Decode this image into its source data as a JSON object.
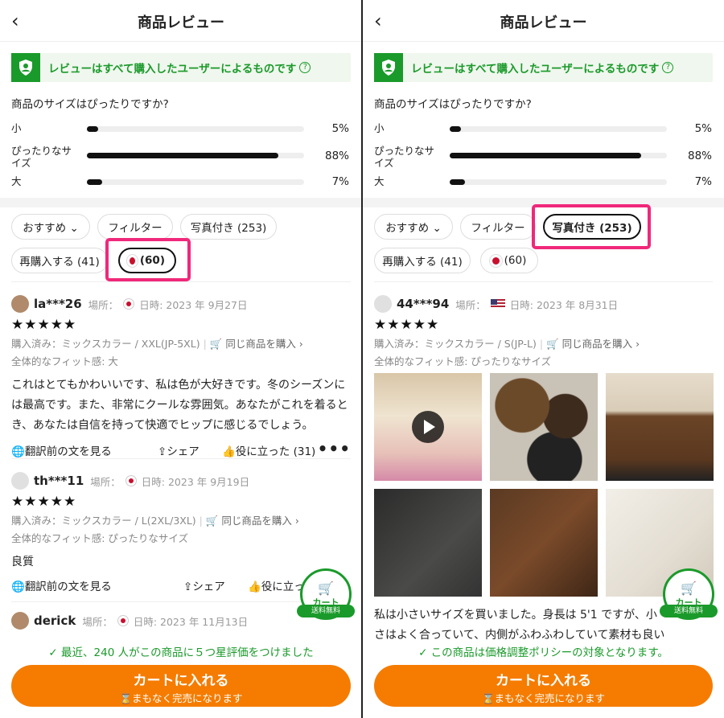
{
  "left": {
    "header": {
      "title": "商品レビュー",
      "back_icon": "‹"
    },
    "banner": {
      "text": "レビューはすべて購入したユーザーによるものです",
      "help_icon": "?"
    },
    "fit": {
      "question": "商品のサイズはぴったりですか?",
      "rows": [
        {
          "label": "小",
          "pct": "5%",
          "value": 0.05
        },
        {
          "label": "ぴったりなサイズ",
          "pct": "88%",
          "value": 0.88
        },
        {
          "label": "大",
          "pct": "7%",
          "value": 0.07
        }
      ]
    },
    "chips": {
      "sort": "おすすめ ⌄",
      "filter": "フィルター",
      "photos": "写真付き (253)",
      "repurchase": "再購入する (41)",
      "country": "(60)"
    },
    "reviews": [
      {
        "user": "la***26",
        "location_label": "場所：",
        "date": "日時: 2023 年 9月27日",
        "stars": "★★★★★",
        "purchased": "購入済み：ミックスカラー / XXL(JP-5XL)",
        "same_item": "同じ商品を購入 ›",
        "fit": "全体的なフィット感: 大",
        "text": "これはとてもかわいいです、私は色が大好きです。冬のシーズンには最高です。また、非常にクールな雰囲気。あなたがこれを着るとき、あなたは自信を持って快適でヒップに感じるでしょう。",
        "translate": "翻訳前の文を見る",
        "share": "シェア",
        "useful": "役に立った (31)"
      },
      {
        "user": "th***11",
        "location_label": "場所：",
        "date": "日時: 2023 年 9月19日",
        "stars": "★★★★★",
        "purchased": "購入済み：ミックスカラー / L(2XL/3XL)",
        "same_item": "同じ商品を購入 ›",
        "fit": "全体的なフィット感: ぴったりなサイズ",
        "text": "良質",
        "translate": "翻訳前の文を見る",
        "share": "シェア",
        "useful": "役に立った"
      },
      {
        "user": "derick",
        "location_label": "場所：",
        "date": "日時: 2023 年 11月13日"
      }
    ],
    "cart_float": {
      "label": "カート",
      "tag": "送料無料"
    },
    "bottom": {
      "notice": "最近、240 人がこの商品に５つ星評価をつけました",
      "cta": "カートに入れる",
      "cta_sub": "まもなく完売になります"
    }
  },
  "right": {
    "header": {
      "title": "商品レビュー",
      "back_icon": "‹"
    },
    "banner": {
      "text": "レビューはすべて購入したユーザーによるものです",
      "help_icon": "?"
    },
    "fit": {
      "question": "商品のサイズはぴったりですか?",
      "rows": [
        {
          "label": "小",
          "pct": "5%",
          "value": 0.05
        },
        {
          "label": "ぴったりなサイズ",
          "pct": "88%",
          "value": 0.88
        },
        {
          "label": "大",
          "pct": "7%",
          "value": 0.07
        }
      ]
    },
    "chips": {
      "sort": "おすすめ ⌄",
      "filter": "フィルター",
      "photos": "写真付き (253)",
      "repurchase": "再購入する (41)",
      "country": "(60)"
    },
    "review": {
      "user": "44***94",
      "location_label": "場所：",
      "date": "日時: 2023 年 8月31日",
      "stars": "★★★★★",
      "purchased": "購入済み：ミックスカラー / S(JP-L)",
      "same_item": "同じ商品を購入 ›",
      "fit": "全体的なフィット感: ぴったりなサイズ",
      "text": "私は小さいサイズを買いました。身長は 5'1 ですが、小さはよく合っていて、内側がふわふわしていて素材も良いです"
    },
    "cart_float": {
      "label": "カート",
      "tag": "送料無料"
    },
    "bottom": {
      "notice": "この商品は価格調整ポリシーの対象となります。",
      "cta": "カートに入れる",
      "cta_sub": "まもなく完売になります"
    }
  },
  "colors": {
    "accent_green": "#1a9a2a",
    "cta_orange": "#f57c00",
    "highlight_pink": "#f0287a"
  }
}
